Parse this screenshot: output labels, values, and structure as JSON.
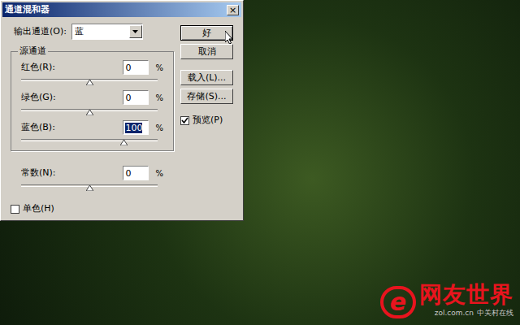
{
  "window": {
    "title": "通道混和器",
    "close": "×"
  },
  "output_channel": {
    "label": "输出通道(O):",
    "value": "蓝"
  },
  "source_group": {
    "title": "源通道",
    "channels": [
      {
        "label": "红色(R):",
        "value": "0",
        "unit": "%",
        "level": 0.5,
        "selected": false
      },
      {
        "label": "绿色(G):",
        "value": "0",
        "unit": "%",
        "level": 0.5,
        "selected": false
      },
      {
        "label": "蓝色(B):",
        "value": "100",
        "unit": "%",
        "level": 0.75,
        "selected": true
      }
    ]
  },
  "constant": {
    "label": "常数(N):",
    "value": "0",
    "unit": "%",
    "level": 0.5
  },
  "monochrome": {
    "label": "单色(H)",
    "checked": false
  },
  "buttons": [
    {
      "label": "好",
      "default": true
    },
    {
      "label": "取消",
      "default": false
    },
    {
      "label": "载入(L)...",
      "default": false
    },
    {
      "label": "存储(S)...",
      "default": false
    }
  ],
  "preview": {
    "label": "预览(P)",
    "checked": true
  },
  "watermark": {
    "logo": "e",
    "title": "网友世界",
    "site": "zol.com.cn",
    "brand": "中关村在线"
  }
}
